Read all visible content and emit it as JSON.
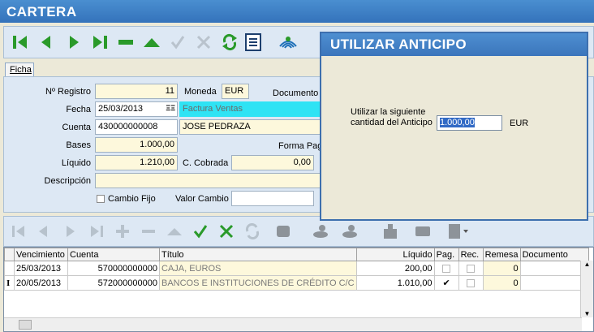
{
  "window": {
    "title": "CARTERA"
  },
  "toolbar": {
    "buttons": [
      {
        "icon": "first-record-icon"
      },
      {
        "icon": "prev-record-icon"
      },
      {
        "icon": "next-record-icon"
      },
      {
        "icon": "last-record-icon"
      },
      {
        "icon": "delete-record-icon"
      },
      {
        "icon": "up-icon"
      },
      {
        "icon": "confirm-icon"
      },
      {
        "icon": "cancel-icon"
      },
      {
        "icon": "refresh-icon"
      },
      {
        "icon": "list-icon"
      },
      {
        "icon": "fingerprint-icon"
      }
    ]
  },
  "tabs": {
    "ficha": "Ficha"
  },
  "form": {
    "registro_label": "Nº Registro",
    "registro_value": "11",
    "moneda_label": "Moneda",
    "moneda_value": "EUR",
    "documento_label": "Documento",
    "fecha_label": "Fecha",
    "fecha_value": "25/03/2013",
    "tipo_value": "Factura Ventas",
    "cuenta_label": "Cuenta",
    "cuenta_value": "430000000008",
    "cuenta_nombre": "JOSE PEDRAZA",
    "bases_label": "Bases",
    "bases_value": "1.000,00",
    "forma_pago_label": "Forma Pag",
    "liquido_label": "Líquido",
    "liquido_value": "1.210,00",
    "cobrada_label": "C. Cobrada",
    "cobrada_value": "0,00",
    "descripcion_label": "Descripción",
    "descripcion_value": "",
    "cambio_fijo_label": "Cambio Fijo",
    "valor_cambio_label": "Valor Cambio",
    "valor_cambio_value": ""
  },
  "grid": {
    "columns": [
      "Vencimiento",
      "Cuenta",
      "Título",
      "Líquido",
      "Pag.",
      "Rec.",
      "Remesa",
      "Documento"
    ],
    "rows": [
      {
        "vencimiento": "25/03/2013",
        "cuenta": "570000000000",
        "titulo": "CAJA, EUROS",
        "liquido": "200,00",
        "pag": false,
        "rec": false,
        "remesa": "0",
        "documento": ""
      },
      {
        "vencimiento": "20/05/2013",
        "cuenta": "572000000000",
        "titulo": "BANCOS E INSTITUCIONES DE CRÉDITO C/C",
        "liquido": "1.010,00",
        "pag": true,
        "rec": false,
        "remesa": "0",
        "documento": ""
      }
    ]
  },
  "dialog": {
    "title": "UTILIZAR ANTICIPO",
    "label_line1": "Utilizar la siguiente",
    "label_line2": "cantidad del Anticipo",
    "amount": "1.000,00",
    "currency": "EUR"
  },
  "colors": {
    "title_bar": "#3f7fc4",
    "panel": "#dde8f4",
    "highlight_field": "#2fe3f4",
    "readonly_field": "#fdf8dc"
  }
}
